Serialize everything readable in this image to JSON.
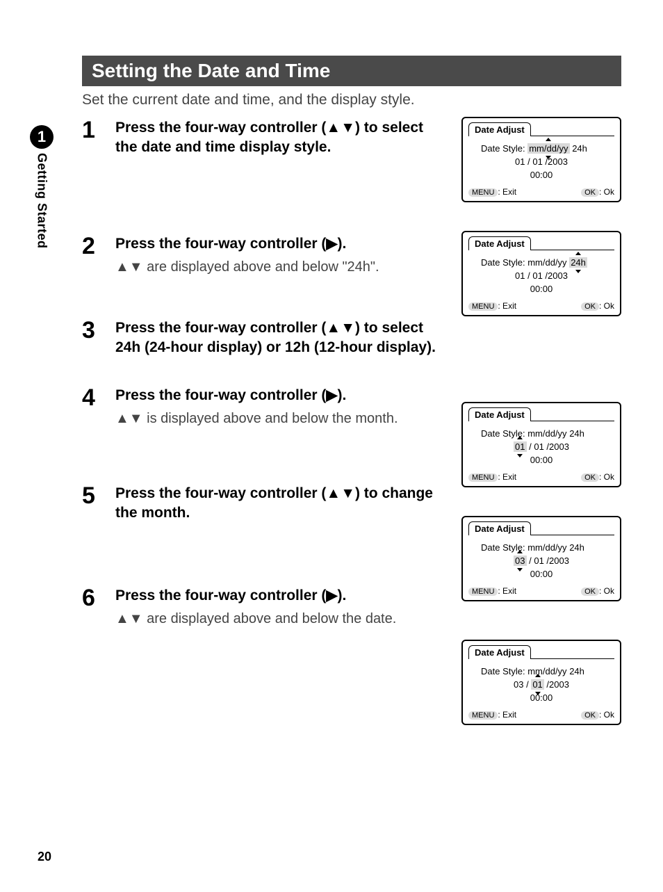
{
  "page_number": "20",
  "side_tab": {
    "number": "1",
    "label": "Getting Started"
  },
  "section_title": "Setting the Date and Time",
  "intro": "Set the current date and time, and the display style.",
  "steps": [
    {
      "num": "1",
      "title": "Press the four-way controller (▲▼) to select the date and time display style.",
      "desc": ""
    },
    {
      "num": "2",
      "title": "Press the four-way controller (▶).",
      "desc": "▲▼ are displayed above and below \"24h\"."
    },
    {
      "num": "3",
      "title": "Press the four-way controller (▲▼) to select 24h (24-hour display) or 12h (12-hour display).",
      "desc": ""
    },
    {
      "num": "4",
      "title": "Press the four-way controller (▶).",
      "desc": "▲▼ is displayed above and below the month."
    },
    {
      "num": "5",
      "title": "Press the four-way controller (▲▼) to change the month.",
      "desc": ""
    },
    {
      "num": "6",
      "title": "Press the four-way controller (▶).",
      "desc": "▲▼ are displayed above and below the date."
    }
  ],
  "lcd_common": {
    "title": "Date Adjust",
    "style_label": "Date Style:",
    "menu_btn": "MENU",
    "exit_label": ": Exit",
    "ok_btn": "OK",
    "ok_label": ": Ok"
  },
  "lcd1": {
    "style_val": "mm/dd/yy",
    "hour": "24h",
    "date": "01 / 01 /2003",
    "time": "00:00"
  },
  "lcd2": {
    "style_val": "mm/dd/yy",
    "hour": "24h",
    "date": "01 / 01 /2003",
    "time": "00:00"
  },
  "lcd3": {
    "style_val": "mm/dd/yy",
    "hour": "24h",
    "mm": "01",
    "rest": " / 01 /2003",
    "time": "00:00"
  },
  "lcd4": {
    "style_val": "mm/dd/yy",
    "hour": "24h",
    "mm": "03",
    "rest": " / 01 /2003",
    "time": "00:00"
  },
  "lcd5": {
    "style_val": "mm/dd/yy",
    "hour": "24h",
    "pre": "03 / ",
    "dd": "01",
    "rest": " /2003",
    "time": "00:00"
  }
}
